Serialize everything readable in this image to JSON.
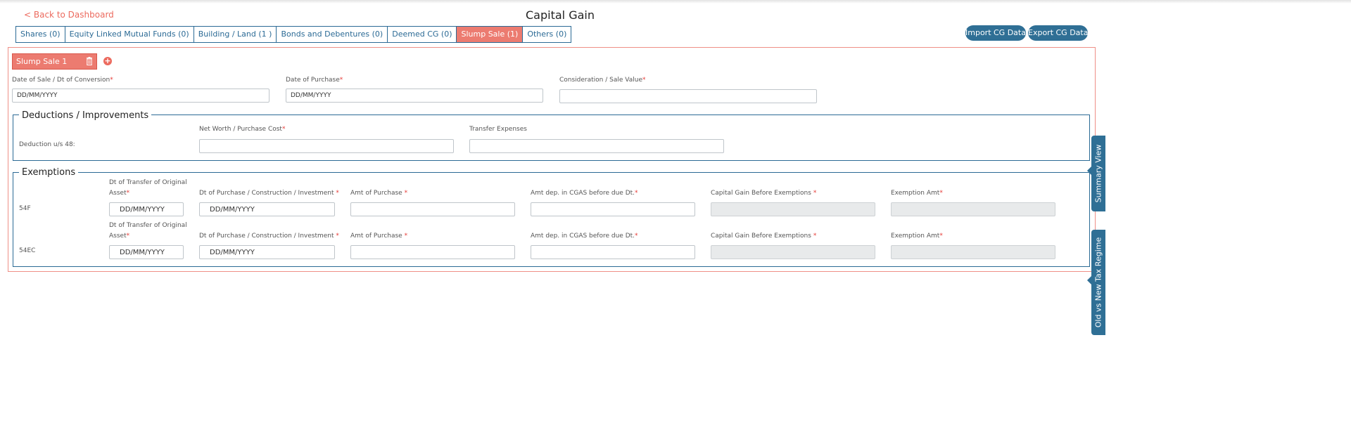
{
  "header": {
    "back_link": "< Back to Dashboard",
    "title": "Capital Gain"
  },
  "tabs": [
    {
      "label": "Shares (0)"
    },
    {
      "label": "Equity Linked Mutual Funds (0)"
    },
    {
      "label": "Building / Land (1 )"
    },
    {
      "label": "Bonds and Debentures (0)"
    },
    {
      "label": "Deemed CG (0)"
    },
    {
      "label": "Slump Sale (1)",
      "active": true
    },
    {
      "label": "Others (0)"
    }
  ],
  "actions": {
    "import_label": "Import CG Data",
    "export_label": "Export CG Data"
  },
  "item": {
    "label": "Slump Sale 1",
    "delete_icon": "trash-icon",
    "add_icon": "plus-circle-icon"
  },
  "sale_fields": {
    "date_of_sale_label": "Date of Sale / Dt of Conversion",
    "date_of_sale_value": "DD/MM/YYYY",
    "date_of_purchase_label": "Date of Purchase",
    "date_of_purchase_value": "DD/MM/YYYY",
    "consideration_label": "Consideration / Sale Value",
    "consideration_value": "",
    "required_mark": "*"
  },
  "deductions": {
    "legend": "Deductions / Improvements",
    "row_label": "Deduction u/s 48:",
    "net_worth_label": "Net Worth / Purchase Cost",
    "net_worth_value": "",
    "transfer_label": "Transfer Expenses",
    "transfer_value": ""
  },
  "exemptions": {
    "legend": "Exemptions",
    "col_transfer_line1": "Dt of Transfer of Original",
    "col_transfer_line2": "Asset",
    "col_purchase": "Dt of Purchase / Construction / Investment ",
    "col_amt_purchase": "Amt of Purchase ",
    "col_amt_cgas": "Amt dep. in CGAS before due Dt.",
    "col_cg_before": "Capital Gain Before Exemptions ",
    "col_exemption": "Exemption Amt",
    "rows": [
      {
        "section": "54F",
        "transfer_date": "DD/MM/YYYY",
        "purchase_date": "DD/MM/YYYY",
        "amt_purchase": "",
        "amt_cgas": "",
        "cg_before": "",
        "exemption": ""
      },
      {
        "section": "54EC",
        "transfer_date": "DD/MM/YYYY",
        "purchase_date": "DD/MM/YYYY",
        "amt_purchase": "",
        "amt_cgas": "",
        "cg_before": "",
        "exemption": ""
      }
    ]
  },
  "side_tabs": {
    "summary": "Summary View",
    "regime": "Old vs New Tax Regime"
  },
  "colors": {
    "accent": "#ec7b70",
    "primary": "#2f6f95",
    "required": "#e53935"
  }
}
